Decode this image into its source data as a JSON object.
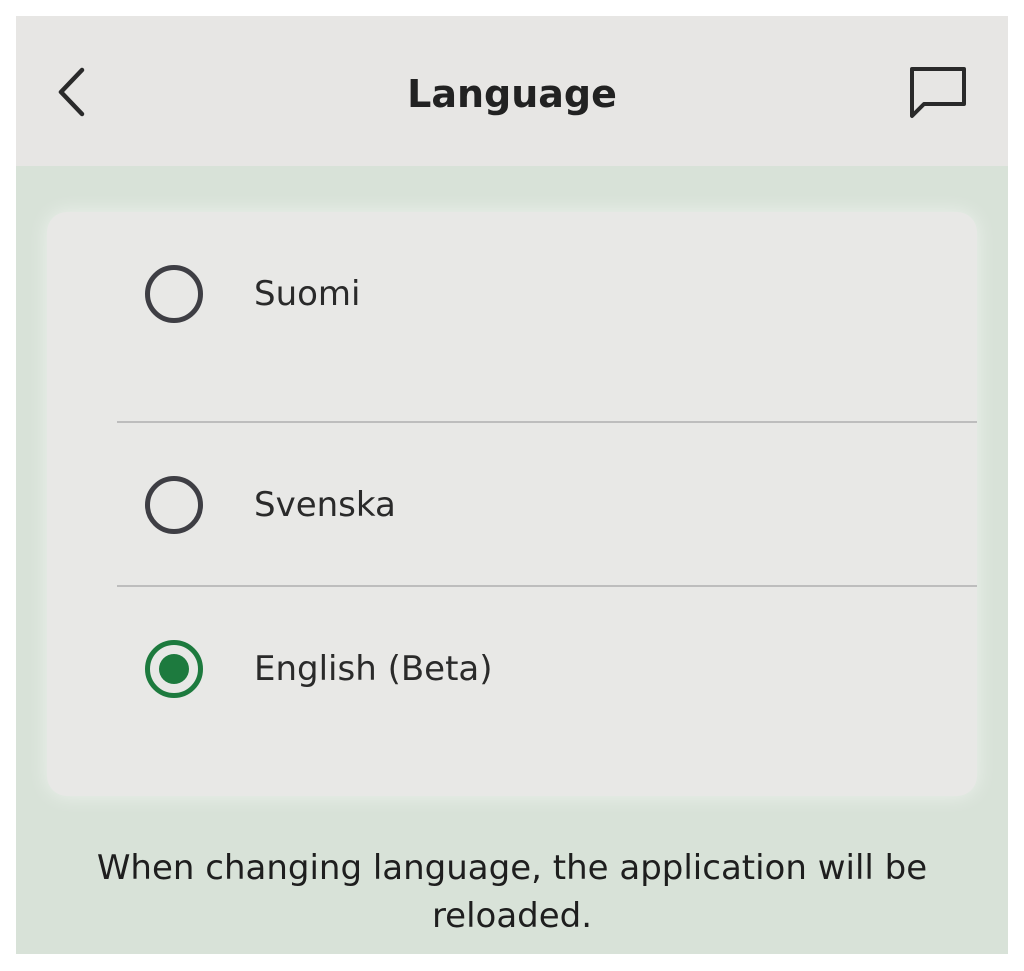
{
  "header": {
    "title": "Language",
    "back_icon": "chevron-left-icon",
    "feedback_icon": "chat-bubble-icon"
  },
  "languages": [
    {
      "label": "Suomi",
      "selected": false
    },
    {
      "label": "Svenska",
      "selected": false
    },
    {
      "label": "English (Beta)",
      "selected": true
    }
  ],
  "notice": "When changing language, the application will be reloaded.",
  "colors": {
    "background": "#d8e2d8",
    "header": "#e7e6e4",
    "card": "#e8e8e6",
    "accent": "#1d7a3e",
    "radio_unchecked": "#3e3e44"
  }
}
